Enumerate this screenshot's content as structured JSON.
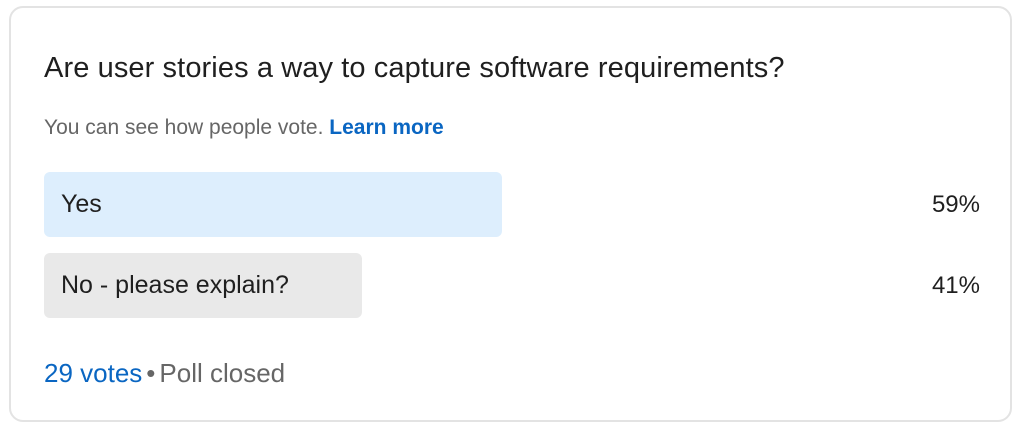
{
  "poll": {
    "question": "Are user stories a way to capture software requirements?",
    "visibility_text": "You can see how people vote.",
    "learn_more_label": "Learn more",
    "options": [
      {
        "label": "Yes",
        "percent_label": "59%",
        "percent": 59,
        "leading": true
      },
      {
        "label": "No - please explain?",
        "percent_label": "41%",
        "percent": 41,
        "leading": false
      }
    ],
    "votes_label": "29 votes",
    "separator": "•",
    "status": "Poll closed"
  },
  "colors": {
    "accent": "#0a66c2",
    "leading_bar": "#ddeefd",
    "other_bar": "#e9e9e9",
    "text_primary": "#1f1f1f",
    "text_secondary": "#666666"
  }
}
